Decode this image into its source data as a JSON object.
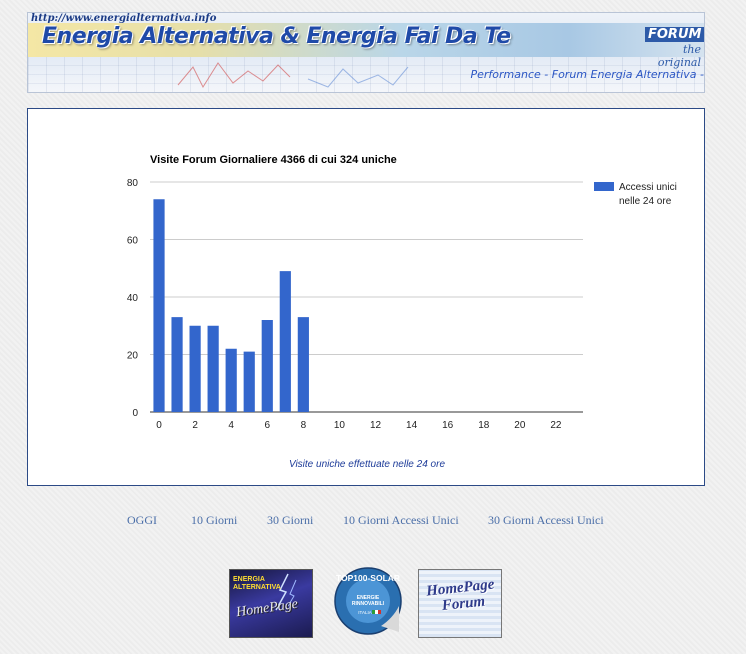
{
  "banner": {
    "url": "http://www.energialternativa.info",
    "title": "Energia Alternativa & Energia Fai Da Te",
    "forum_badge": "FORUM",
    "forum_tagline": "the original",
    "subtitle": "Performance - Forum Energia Alternativa -"
  },
  "chart_data": {
    "type": "bar",
    "title": "Visite Forum Giornaliere 4366 di cui 324 uniche",
    "xlabel": "Visite uniche effettuate nelle 24 ore",
    "ylabel": "",
    "ylim": [
      0,
      80
    ],
    "yticks": [
      0,
      20,
      40,
      60,
      80
    ],
    "xticks": [
      0,
      2,
      4,
      6,
      8,
      10,
      12,
      14,
      16,
      18,
      20,
      22
    ],
    "categories": [
      0,
      1,
      2,
      3,
      4,
      5,
      6,
      7,
      8,
      9,
      10,
      11,
      12,
      13,
      14,
      15,
      16,
      17,
      18,
      19,
      20,
      21,
      22,
      23
    ],
    "series": [
      {
        "name": "Accessi unici nelle 24 ore",
        "color": "#3366cc",
        "values": [
          74,
          33,
          30,
          30,
          22,
          21,
          32,
          49,
          33,
          0,
          0,
          0,
          0,
          0,
          0,
          0,
          0,
          0,
          0,
          0,
          0,
          0,
          0,
          0
        ]
      }
    ],
    "grid": true,
    "legend": "right",
    "legend_lines": [
      "Accessi unici",
      "nelle 24 ore"
    ]
  },
  "nav": {
    "links": [
      {
        "label": "OGGI"
      },
      {
        "label": "10 Giorni"
      },
      {
        "label": "30 Giorni"
      },
      {
        "label": "10 Giorni Accessi Unici"
      },
      {
        "label": "30 Giorni Accessi Unici"
      }
    ]
  },
  "badges": {
    "home": {
      "line1": "ENERGIA",
      "line2": "ALTERNATIVA",
      "main": "HomePage"
    },
    "solar": {
      "top": "TOP100-SOLAR",
      "mid1": "ENERGIE",
      "mid2": "RINNOVABILI",
      "bottom": "ITALIA"
    },
    "forum": {
      "line1": "HomePage",
      "line2": "Forum"
    }
  }
}
